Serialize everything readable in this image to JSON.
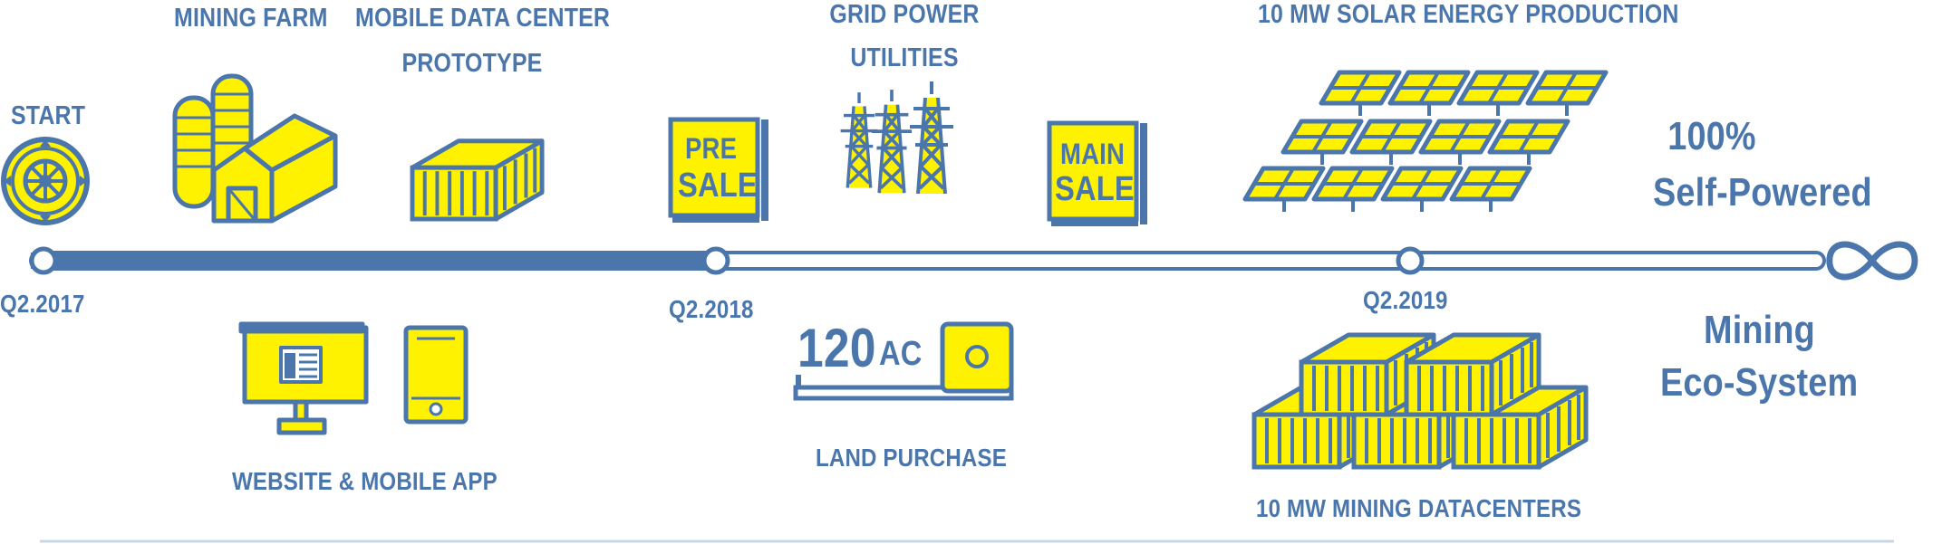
{
  "colors": {
    "blue": "#4a76ac",
    "yellow": "#fff200",
    "line": "#c9d7e4"
  },
  "icons": [
    "steering-wheel-icon",
    "silo-barn-icon",
    "container-icon",
    "presale-sign-icon",
    "power-tower-icon",
    "mainsale-sign-icon",
    "solar-panel-icon",
    "infinity-icon",
    "monitor-icon",
    "phone-icon",
    "land-plot-icon",
    "datacenter-stack-icon"
  ],
  "top": {
    "start": "START",
    "mining_farm": "MINING FARM",
    "mobile_dc_line1": "MOBILE DATA CENTER",
    "mobile_dc_line2": "PROTOTYPE",
    "grid_line1": "GRID POWER",
    "grid_line2": "UTILITIES",
    "solar": "10 MW SOLAR ENERGY PRODUCTION",
    "self_powered_line1": "100%",
    "self_powered_line2": "Self-Powered"
  },
  "signs": {
    "pre_line1": "PRE",
    "pre_line2": "SALE",
    "main_line1": "MAIN",
    "main_line2": "SALE"
  },
  "milestones": [
    "Q2.2017",
    "Q2.2018",
    "Q2.2019"
  ],
  "bottom": {
    "website": "WEBSITE & MOBILE APP",
    "land_number": "120",
    "land_unit": "AC",
    "land_label": "LAND PURCHASE",
    "datacenters": "10 MW MINING DATACENTERS",
    "ecosystem_line1": "Mining",
    "ecosystem_line2": "Eco-System"
  }
}
